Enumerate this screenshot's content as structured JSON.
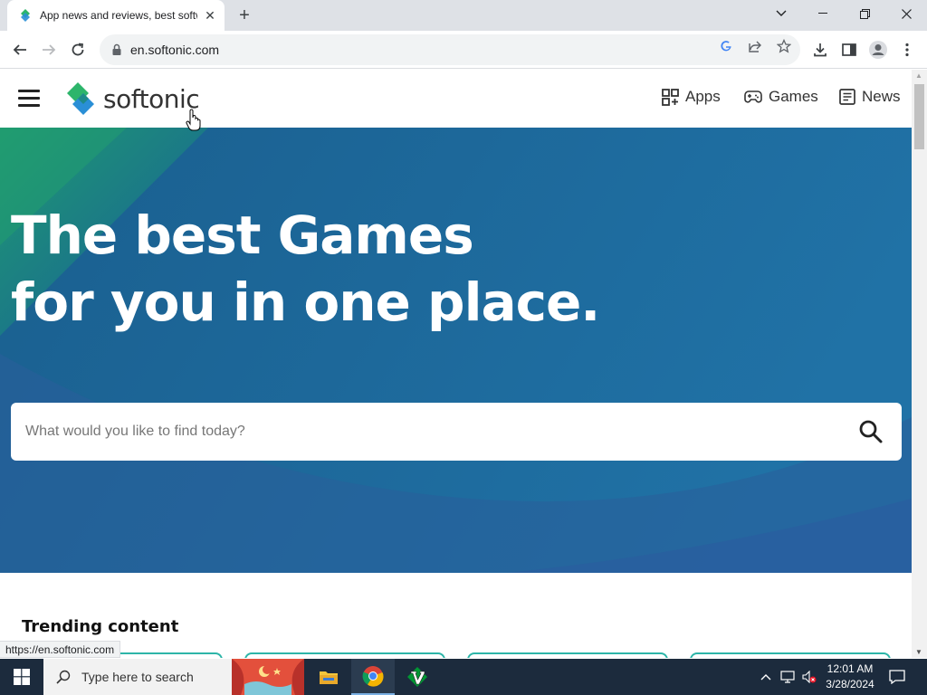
{
  "browser": {
    "tab_title": "App news and reviews, best software downloads",
    "url": "en.softonic.com",
    "status_link": "https://en.softonic.com"
  },
  "site": {
    "logo_text": "softonic",
    "nav": [
      {
        "label": "Apps",
        "icon": "grid-icon"
      },
      {
        "label": "Games",
        "icon": "gamepad-icon"
      },
      {
        "label": "News",
        "icon": "newspaper-icon"
      }
    ],
    "hero_line1": "The best Games",
    "hero_line2": "for you in one place.",
    "search_placeholder": "What would you like to find today?",
    "trending_title": "Trending content"
  },
  "taskbar": {
    "search_text": "Type here to search",
    "time": "12:01 AM",
    "date": "3/28/2024"
  },
  "colors": {
    "hero_blue": "#1f6a9c",
    "hero_green": "#1f9a72",
    "brand_green": "#2db56b",
    "brand_blue": "#2a8fd6"
  }
}
